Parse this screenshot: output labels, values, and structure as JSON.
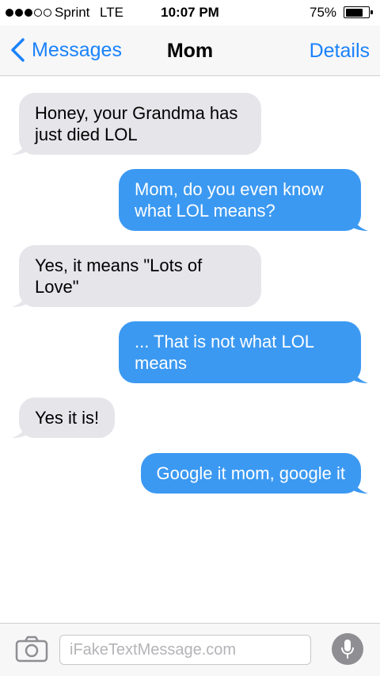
{
  "status_bar": {
    "carrier": "Sprint",
    "network": "LTE",
    "time": "10:07 PM",
    "battery_percent": "75%",
    "battery_level": 0.75,
    "signal_strength": 3
  },
  "nav": {
    "back_label": "Messages",
    "title": "Mom",
    "details_label": "Details"
  },
  "colors": {
    "accent": "#1a82fb",
    "outgoing_bubble": "#3b99f2",
    "incoming_bubble": "#e5e5ea"
  },
  "messages": [
    {
      "direction": "incoming",
      "text": "Honey, your Grandma has just died LOL"
    },
    {
      "direction": "outgoing",
      "text": "Mom, do you even know what LOL means?"
    },
    {
      "direction": "incoming",
      "text": "Yes, it means \"Lots of Love\""
    },
    {
      "direction": "outgoing",
      "text": "... That is not what LOL means"
    },
    {
      "direction": "incoming",
      "text": "Yes it is!"
    },
    {
      "direction": "outgoing",
      "text": "Google it mom, google it"
    }
  ],
  "composer": {
    "placeholder": "iFakeTextMessage.com",
    "value": "",
    "camera_icon": "camera-icon",
    "mic_icon": "microphone-icon"
  }
}
